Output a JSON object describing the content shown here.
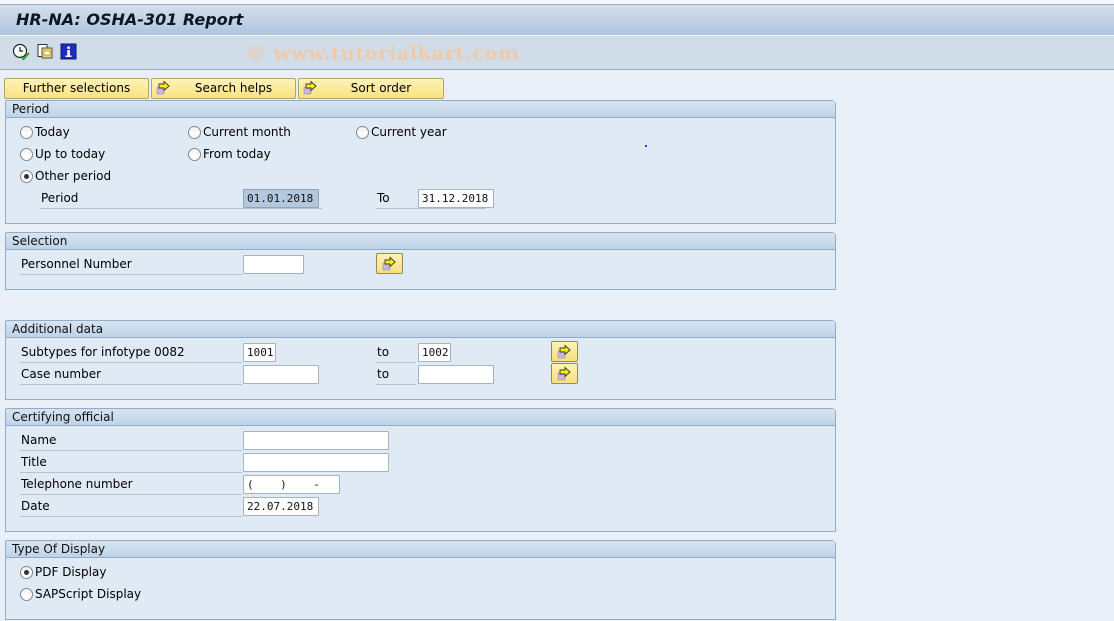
{
  "window": {
    "title": "HR-NA: OSHA-301 Report",
    "watermark": "© www.tutorialkart.com"
  },
  "toolbar": {
    "icons": [
      {
        "name": "execute-clock-icon",
        "tooltip": "Execute"
      },
      {
        "name": "get-variant-icon",
        "tooltip": "Get Variant"
      },
      {
        "name": "info-icon",
        "tooltip": "Program Documentation"
      }
    ]
  },
  "selection_buttons": {
    "further_selections": "Further selections",
    "search_helps": "Search helps",
    "sort_order": "Sort order"
  },
  "period": {
    "title": "Period",
    "options": [
      {
        "label": "Today",
        "selected": false
      },
      {
        "label": "Current month",
        "selected": false
      },
      {
        "label": "Current year",
        "selected": false
      },
      {
        "label": "Up to today",
        "selected": false
      },
      {
        "label": "From today",
        "selected": false
      },
      {
        "label": "Other period",
        "selected": true
      }
    ],
    "period_label": "Period",
    "from_value": "01.01.2018",
    "to_label": "To",
    "to_value": "31.12.2018"
  },
  "selection": {
    "title": "Selection",
    "personnel_number_label": "Personnel Number",
    "personnel_number_value": ""
  },
  "additional_data": {
    "title": "Additional data",
    "rows": [
      {
        "label": "Subtypes for infotype 0082",
        "from": "1001",
        "to_label": "to",
        "to": "1002"
      },
      {
        "label": "Case number",
        "from": "",
        "to_label": "to",
        "to": ""
      }
    ]
  },
  "certifying_official": {
    "title": "Certifying official",
    "fields": [
      {
        "label": "Name",
        "value": ""
      },
      {
        "label": "Title",
        "value": ""
      },
      {
        "label": "Telephone number",
        "value": "(    )    -"
      },
      {
        "label": "Date",
        "value": "22.07.2018"
      }
    ]
  },
  "type_of_display": {
    "title": "Type Of Display",
    "options": [
      {
        "label": "PDF Display",
        "selected": true
      },
      {
        "label": "SAPScript Display",
        "selected": false
      }
    ]
  }
}
